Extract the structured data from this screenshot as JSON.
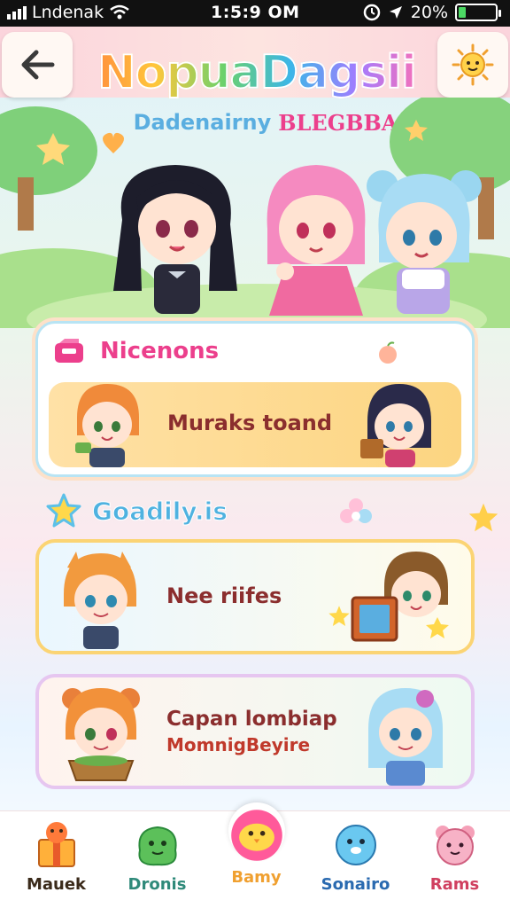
{
  "status_bar": {
    "carrier": "Lndenak",
    "time": "1:5:9 OM",
    "battery": "20%",
    "battery_level": 0.2,
    "icons": [
      "signal-icon",
      "wifi-icon",
      "alarm-icon",
      "location-icon",
      "battery-icon"
    ]
  },
  "header": {
    "back_icon": "arrow-left-icon",
    "mascot_icon": "sun-mascot-icon",
    "title": "NopuaDagsii",
    "subtitle_a": "Dadenairny",
    "subtitle_b": "BLEGBBA"
  },
  "missions": {
    "icon": "inbox-icon",
    "title": "Nicenons",
    "strip_text": "Muraks toand"
  },
  "section": {
    "icon": "star-icon",
    "title": "Goadily.is"
  },
  "rewards_card": {
    "text": "Nee riifes"
  },
  "community_card": {
    "line1": "Capan lombiap",
    "line2": "MomnigBeyire"
  },
  "bottom_nav": {
    "items": [
      {
        "label": "Mauek",
        "icon": "gift-box-icon",
        "color": "#3a2a1a"
      },
      {
        "label": "Dronis",
        "icon": "green-blob-icon",
        "color": "#2f8a7a"
      },
      {
        "label": "Bamy",
        "icon": "chick-icon",
        "color": "#f0a030",
        "active": true
      },
      {
        "label": "Sonairo",
        "icon": "blue-blob-icon",
        "color": "#2a6ab0"
      },
      {
        "label": "Rams",
        "icon": "pink-bear-icon",
        "color": "#d04060"
      }
    ]
  },
  "colors": {
    "accent_pink": "#ec3f8c",
    "accent_blue": "#4fb2e0",
    "card_yellow": "#fcd581",
    "text_brown": "#8b2e2e"
  }
}
